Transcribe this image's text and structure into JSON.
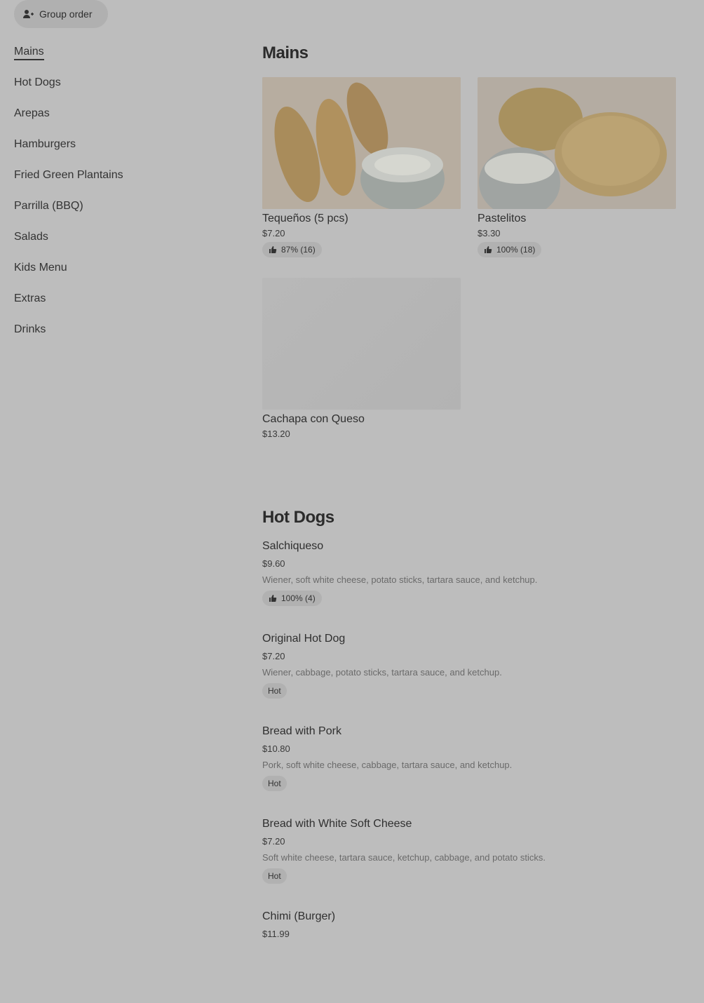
{
  "header": {
    "group_order_label": "Group order"
  },
  "sidebar": {
    "items": [
      {
        "label": "Mains",
        "active": true
      },
      {
        "label": "Hot Dogs"
      },
      {
        "label": "Arepas"
      },
      {
        "label": "Hamburgers"
      },
      {
        "label": "Fried Green Plantains"
      },
      {
        "label": "Parrilla (BBQ)"
      },
      {
        "label": "Salads"
      },
      {
        "label": "Kids Menu"
      },
      {
        "label": "Extras"
      },
      {
        "label": "Drinks"
      }
    ]
  },
  "mains": {
    "title": "Mains",
    "items": [
      {
        "name": "Tequeños (5 pcs)",
        "price": "$7.20",
        "rating": "87% (16)"
      },
      {
        "name": "Pastelitos",
        "price": "$3.30",
        "rating": "100% (18)"
      },
      {
        "name": "Cachapa con Queso",
        "price": "$13.20"
      }
    ]
  },
  "hot_dogs": {
    "title": "Hot Dogs",
    "items": [
      {
        "name": "Salchiqueso",
        "price": "$9.60",
        "desc": "Wiener, soft white cheese, potato sticks, tartara sauce, and ketchup.",
        "rating": "100% (4)"
      },
      {
        "name": "Original Hot Dog",
        "price": "$7.20",
        "desc": "Wiener, cabbage, potato sticks, tartara sauce, and ketchup.",
        "tag": "Hot"
      },
      {
        "name": "Bread with Pork",
        "price": "$10.80",
        "desc": "Pork, soft white cheese, cabbage, tartara sauce, and ketchup.",
        "tag": "Hot"
      },
      {
        "name": "Bread with White Soft Cheese",
        "price": "$7.20",
        "desc": "Soft white cheese, tartara sauce, ketchup, cabbage, and potato sticks.",
        "tag": "Hot"
      },
      {
        "name": "Chimi (Burger)",
        "price": "$11.99"
      }
    ]
  }
}
